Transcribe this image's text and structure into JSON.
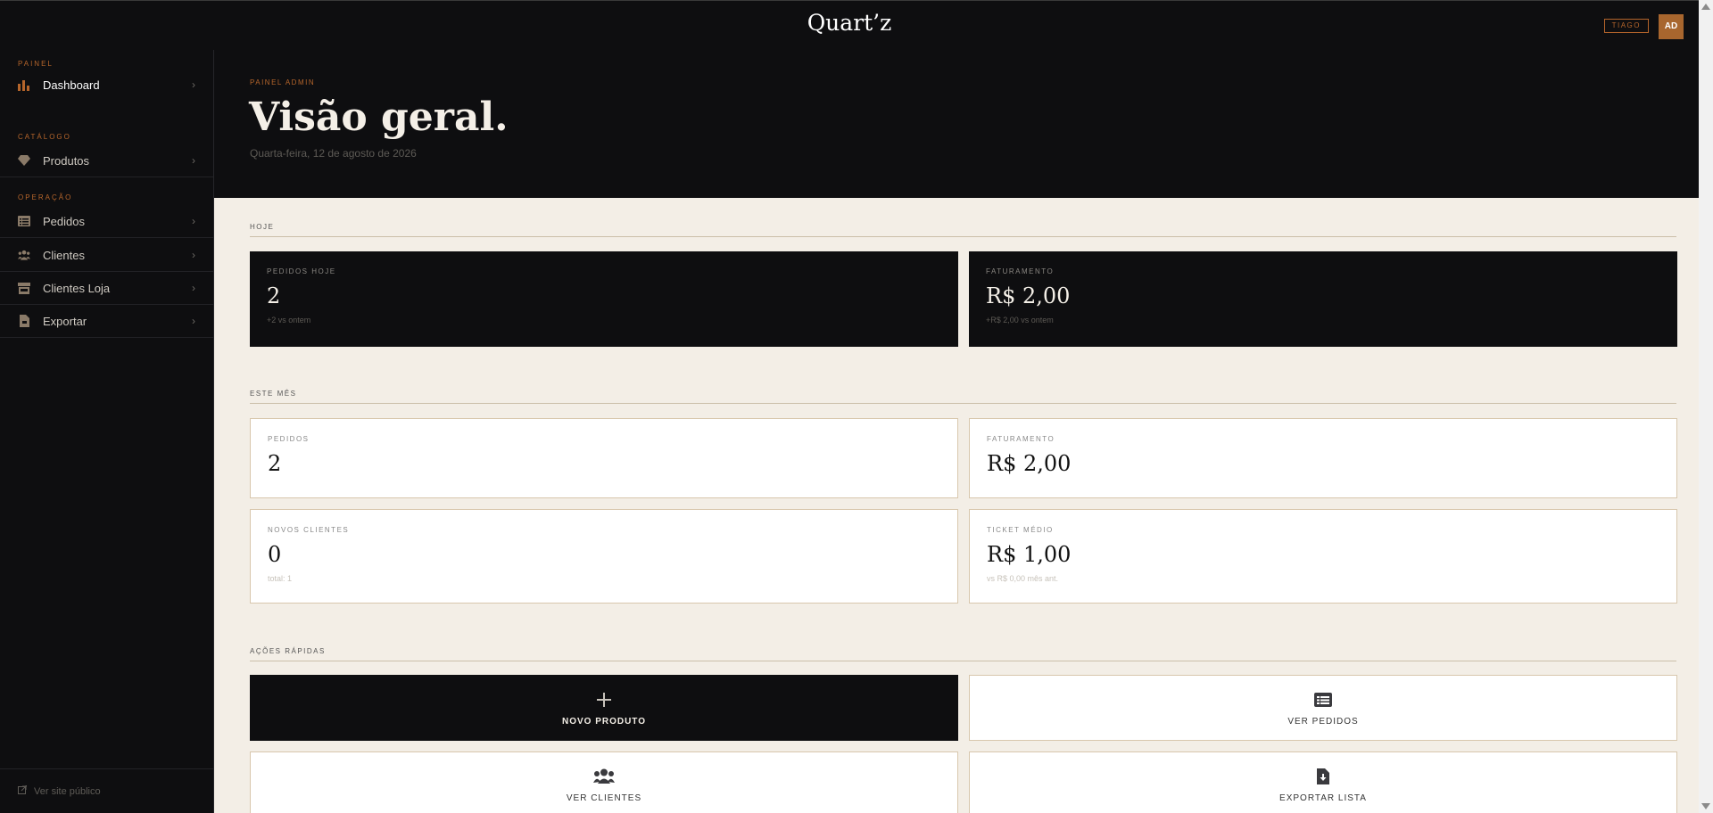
{
  "topbar": {
    "brand": "Quart’z",
    "user_name": "TIAGO",
    "avatar_initials": "AD"
  },
  "sidebar": {
    "sections": [
      {
        "label": "PAINEL"
      },
      {
        "label": "CATÁLOGO"
      },
      {
        "label": "OPERAÇÃO"
      }
    ],
    "items": [
      {
        "label": "Dashboard",
        "icon": "bar-chart-icon",
        "active": true
      },
      {
        "label": "Produtos",
        "icon": "gem-icon"
      },
      {
        "label": "Pedidos",
        "icon": "list-icon"
      },
      {
        "label": "Clientes",
        "icon": "users-icon"
      },
      {
        "label": "Clientes Loja",
        "icon": "store-icon"
      },
      {
        "label": "Exportar",
        "icon": "file-export-icon"
      }
    ],
    "footer_link": "Ver site público"
  },
  "hero": {
    "eyebrow": "PAINEL ADMIN",
    "title": "Visão geral.",
    "date": "Quarta-feira, 12 de agosto de 2026"
  },
  "today": {
    "label": "HOJE",
    "cards": [
      {
        "label": "PEDIDOS HOJE",
        "value": "2",
        "sub": "+2 vs ontem"
      },
      {
        "label": "FATURAMENTO",
        "value": "R$ 2,00",
        "sub": "+R$ 2,00 vs ontem"
      }
    ]
  },
  "month": {
    "label": "ESTE MÊS",
    "cards": [
      {
        "label": "PEDIDOS",
        "value": "2"
      },
      {
        "label": "FATURAMENTO",
        "value": "R$ 2,00"
      },
      {
        "label": "NOVOS CLIENTES",
        "value": "0",
        "sub": "total: 1"
      },
      {
        "label": "TICKET MÉDIO",
        "value": "R$ 1,00",
        "sub": "vs R$ 0,00 mês ant."
      }
    ]
  },
  "actions": {
    "label": "AÇÕES RÁPIDAS",
    "items": [
      {
        "label": "NOVO PRODUTO",
        "icon": "plus-icon"
      },
      {
        "label": "VER PEDIDOS",
        "icon": "list-icon"
      },
      {
        "label": "VER CLIENTES",
        "icon": "users-icon"
      },
      {
        "label": "EXPORTAR LISTA",
        "icon": "file-download-icon"
      }
    ]
  },
  "colors": {
    "accent": "#b5652b",
    "dark": "#0e0e10",
    "cream": "#f3eee6"
  }
}
